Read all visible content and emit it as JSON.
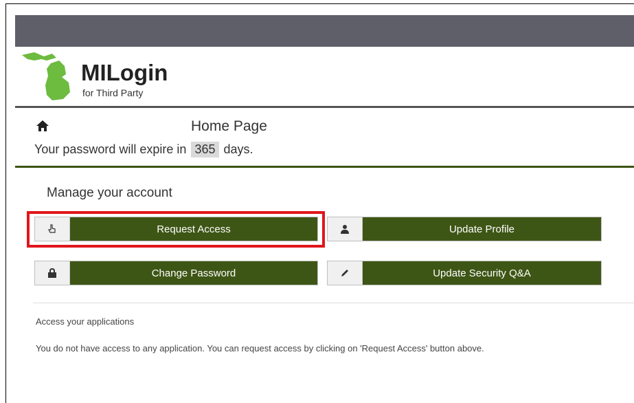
{
  "brand": {
    "title": "MILogin",
    "subtitle": "for Third Party",
    "logo_color": "#6dbb3f"
  },
  "page": {
    "title": "Home Page",
    "expire_prefix": "Your password will expire in",
    "expire_days": "365",
    "expire_suffix": "days."
  },
  "manage": {
    "heading": "Manage your account",
    "buttons": {
      "request_access": {
        "label": "Request Access",
        "icon": "pointing-hand-icon"
      },
      "update_profile": {
        "label": "Update Profile",
        "icon": "user-icon"
      },
      "change_password": {
        "label": "Change Password",
        "icon": "lock-icon"
      },
      "update_security": {
        "label": "Update Security Q&A",
        "icon": "pencil-icon"
      }
    }
  },
  "applications": {
    "heading": "Access your applications",
    "message": "You do not have access to any application. You can request access by clicking on 'Request Access' button above."
  },
  "colors": {
    "topbar": "#5f5f6a",
    "button_green": "#3e5615",
    "highlight_red": "#e0161b"
  }
}
